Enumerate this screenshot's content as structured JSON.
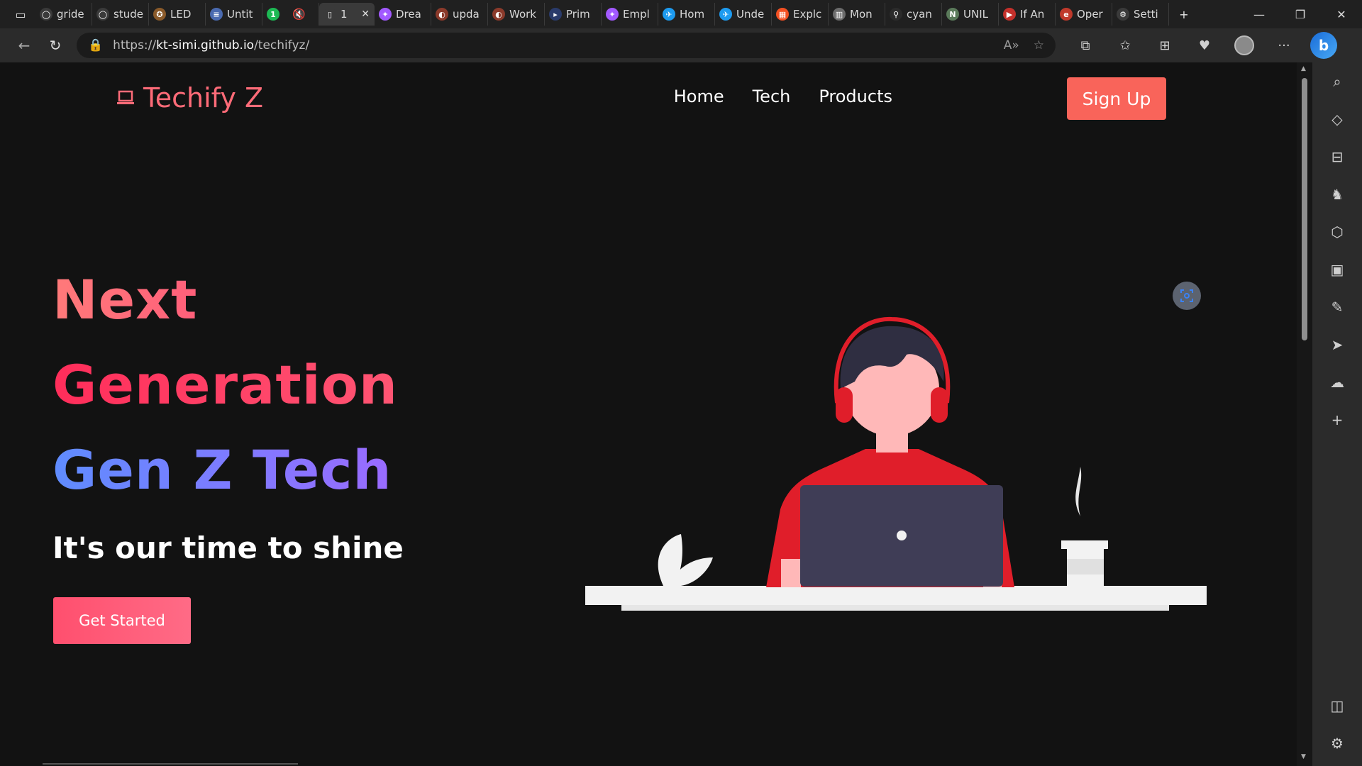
{
  "browser": {
    "tabs": [
      {
        "label": "gride",
        "color": "#3a3a3a",
        "glyph": "◯"
      },
      {
        "label": "stude",
        "color": "#3a3a3a",
        "glyph": "◯"
      },
      {
        "label": "LED",
        "color": "#8a5a2a",
        "glyph": "✪"
      },
      {
        "label": "Untit",
        "color": "#4a6ab0",
        "glyph": "≡"
      },
      {
        "label": "",
        "color": "#1db954",
        "glyph": "1"
      },
      {
        "label": "1",
        "color": "#3a3a3a",
        "glyph": "▯"
      },
      {
        "label": "Drea",
        "color": "#a259ff",
        "glyph": "✦"
      },
      {
        "label": "upda",
        "color": "#8b3a2b",
        "glyph": "◐"
      },
      {
        "label": "Work",
        "color": "#8b3a2b",
        "glyph": "◐"
      },
      {
        "label": "Prim",
        "color": "#2a3b6b",
        "glyph": "▸"
      },
      {
        "label": "Empl",
        "color": "#a259ff",
        "glyph": "✦"
      },
      {
        "label": "Hom",
        "color": "#1d9bf0",
        "glyph": "✈"
      },
      {
        "label": "Unde",
        "color": "#1d9bf0",
        "glyph": "✈"
      },
      {
        "label": "Explc",
        "color": "#f25022",
        "glyph": "▦"
      },
      {
        "label": "Mon",
        "color": "#6b6b6b",
        "glyph": "▥"
      },
      {
        "label": "cyan",
        "color": "#2b2b2b",
        "glyph": "⚲"
      },
      {
        "label": "UNIL",
        "color": "#5a7a5a",
        "glyph": "N"
      },
      {
        "label": "If An",
        "color": "#c4302b",
        "glyph": "▶"
      },
      {
        "label": "Oper",
        "color": "#c0392b",
        "glyph": "e"
      },
      {
        "label": "Setti",
        "color": "#3a3a3a",
        "glyph": "⚙"
      }
    ],
    "url_prefix": "https://",
    "url_domain": "kt-simi.github.io",
    "url_path": "/techifyz/"
  },
  "site": {
    "logo_text": "Techify Z",
    "nav": [
      "Home",
      "Tech",
      "Products"
    ],
    "signup_label": "Sign Up",
    "hero_line1": "Next",
    "hero_line2": "Generation",
    "hero_line3": "Gen Z Tech",
    "tagline": "It's our time to shine",
    "cta_label": "Get Started"
  },
  "colors": {
    "accent": "#f9645a",
    "hero_pink": "#ff4f6e",
    "hero_purple": "#8a6bff",
    "illustration_red": "#e01e2a",
    "laptop": "#3f3d56"
  }
}
